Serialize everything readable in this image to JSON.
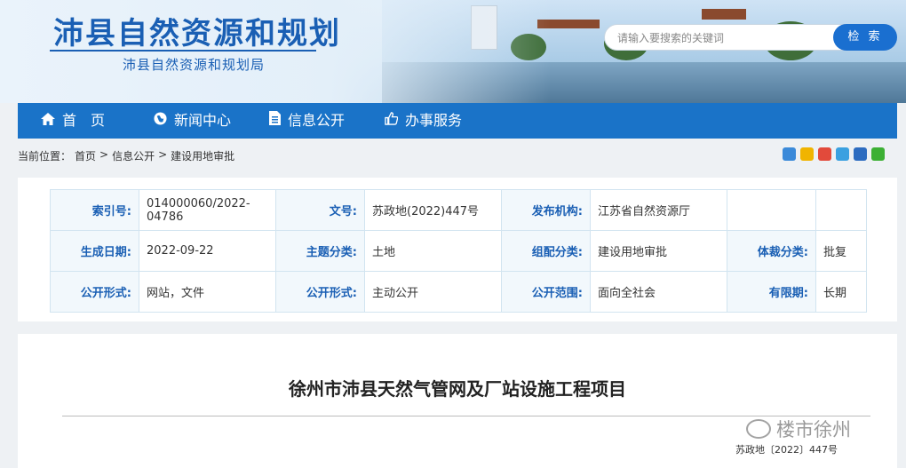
{
  "header": {
    "site_title": "沛县自然资源和规划",
    "site_subtitle": "沛县自然资源和规划局"
  },
  "search": {
    "placeholder": "请输入要搜索的关键词",
    "button_label": "检 索"
  },
  "nav": {
    "items": [
      {
        "label": "首　页",
        "icon": "home-icon"
      },
      {
        "label": "新闻中心",
        "icon": "globe-icon"
      },
      {
        "label": "信息公开",
        "icon": "document-icon"
      },
      {
        "label": "办事服务",
        "icon": "thumbs-up-icon"
      }
    ]
  },
  "breadcrumb": {
    "prefix": "当前位置：",
    "items": [
      "首页",
      "信息公开",
      "建设用地审批"
    ],
    "separator": ">"
  },
  "share_icons": [
    "plus-share-icon",
    "star-share-icon",
    "weibo-share-icon",
    "qzone-share-icon",
    "renren-share-icon",
    "wechat-share-icon"
  ],
  "meta": {
    "rows": [
      [
        {
          "label": "索引号:",
          "value": "014000060/2022-04786"
        },
        {
          "label": "文号:",
          "value": "苏政地(2022)447号"
        },
        {
          "label": "发布机构:",
          "value": "江苏省自然资源厅"
        },
        {
          "label": "",
          "value": ""
        }
      ],
      [
        {
          "label": "生成日期:",
          "value": "2022-09-22"
        },
        {
          "label": "主题分类:",
          "value": "土地"
        },
        {
          "label": "组配分类:",
          "value": "建设用地审批"
        },
        {
          "label": "体裁分类:",
          "value": "批复"
        }
      ],
      [
        {
          "label": "公开形式:",
          "value": "网站，文件"
        },
        {
          "label": "公开形式:",
          "value": "主动公开"
        },
        {
          "label": "公开范围:",
          "value": "面向全社会"
        },
        {
          "label": "有限期:",
          "value": "长期"
        }
      ]
    ]
  },
  "article": {
    "title": "徐州市沛县天然气管网及厂站设施工程项目",
    "doc_number": "苏政地〔2022〕447号",
    "watermark": "楼市徐州"
  },
  "colors": {
    "brand_blue": "#1a73c8",
    "title_blue": "#1a5fb4",
    "table_border": "#d2e4f0"
  }
}
